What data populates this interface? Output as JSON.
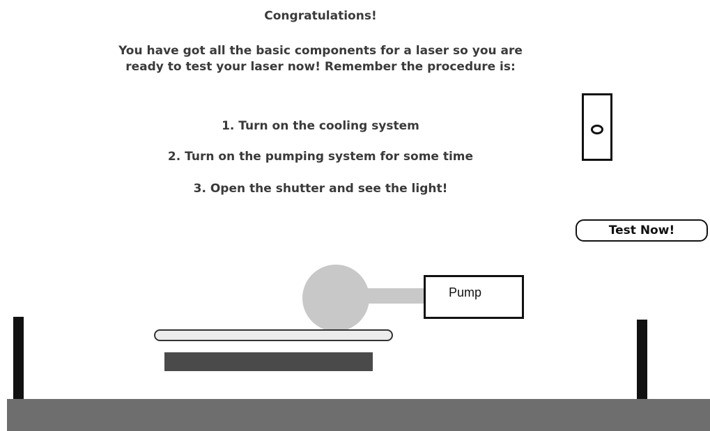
{
  "message": {
    "title": "Congratulations!",
    "intro": "You have got all the basic components for a laser so you are ready to test your laser now! Remember the procedure is:",
    "steps": [
      "1. Turn on the cooling system",
      "2. Turn on the pumping system for some time",
      "3. Open the shutter and see the light!"
    ]
  },
  "controls": {
    "test_button_label": "Test Now!",
    "pump_label": "Pump"
  },
  "colors": {
    "bench": "#6e6e6e",
    "lamp": "#c8c8c8",
    "cooling_plate": "#4a4a4a",
    "text": "#3a3a3a"
  }
}
